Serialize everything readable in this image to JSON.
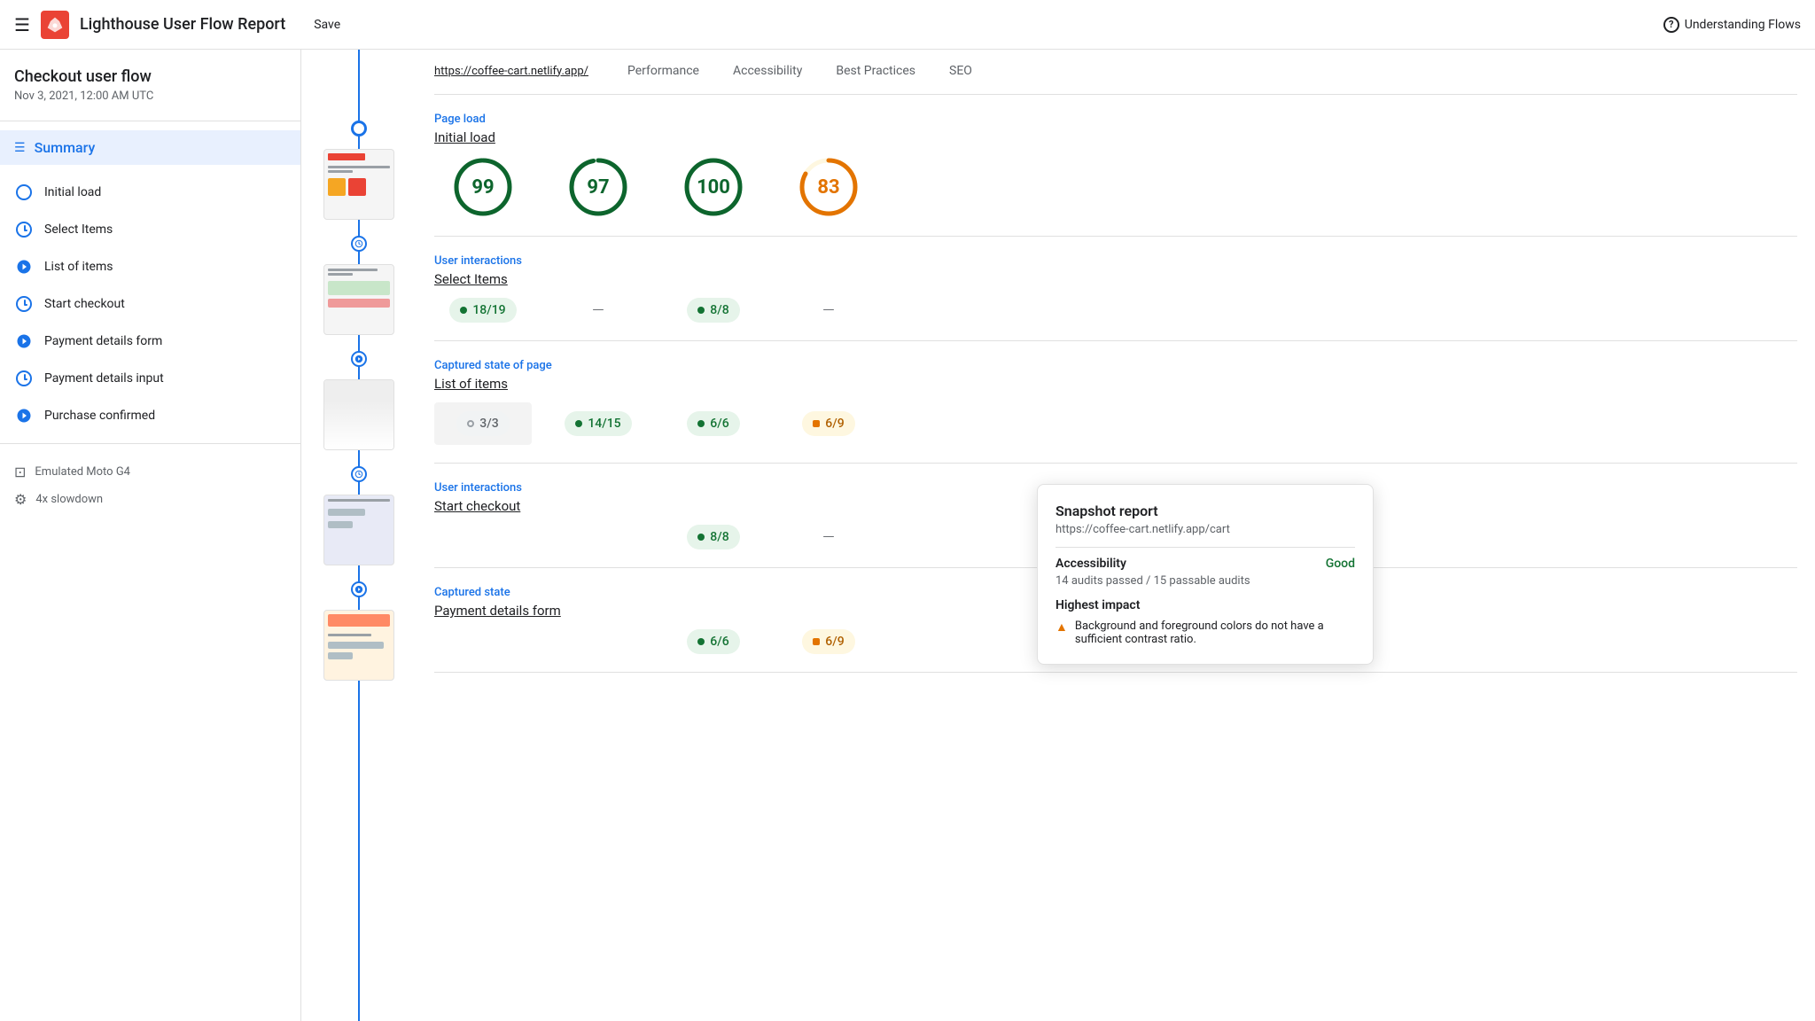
{
  "app": {
    "title": "Lighthouse User Flow Report",
    "save_label": "Save",
    "help_label": "Understanding Flows",
    "logo_icon": "lighthouse-icon"
  },
  "sidebar": {
    "flow_title": "Checkout user flow",
    "flow_date": "Nov 3, 2021, 12:00 AM UTC",
    "summary_label": "Summary",
    "nav_items": [
      {
        "id": "initial-load",
        "label": "Initial load",
        "type": "circle"
      },
      {
        "id": "select-items",
        "label": "Select Items",
        "type": "clock"
      },
      {
        "id": "list-of-items",
        "label": "List of items",
        "type": "snap"
      },
      {
        "id": "start-checkout",
        "label": "Start checkout",
        "type": "clock"
      },
      {
        "id": "payment-details-form",
        "label": "Payment details form",
        "type": "snap"
      },
      {
        "id": "payment-details-input",
        "label": "Payment details input",
        "type": "clock"
      },
      {
        "id": "purchase-confirmed",
        "label": "Purchase confirmed",
        "type": "snap"
      }
    ],
    "footer": [
      {
        "label": "Emulated Moto G4",
        "icon": "device-icon"
      },
      {
        "label": "4x slowdown",
        "icon": "slowdown-icon"
      }
    ]
  },
  "content": {
    "url": "https://coffee-cart.netlify.app/",
    "tabs": [
      {
        "id": "performance",
        "label": "Performance"
      },
      {
        "id": "accessibility",
        "label": "Accessibility"
      },
      {
        "id": "best-practices",
        "label": "Best Practices"
      },
      {
        "id": "seo",
        "label": "SEO"
      }
    ],
    "sections": [
      {
        "id": "page-load",
        "type_label": "Page load",
        "name_label": "Initial load",
        "scores": [
          {
            "type": "circle",
            "value": "99",
            "color": "green"
          },
          {
            "type": "circle",
            "value": "97",
            "color": "green"
          },
          {
            "type": "circle",
            "value": "100",
            "color": "green"
          },
          {
            "type": "circle",
            "value": "83",
            "color": "orange"
          }
        ]
      },
      {
        "id": "user-interactions-1",
        "type_label": "User interactions",
        "name_label": "Select Items",
        "scores": [
          {
            "type": "badge",
            "value": "18/19",
            "color": "green",
            "dot": "green"
          },
          {
            "type": "dash"
          },
          {
            "type": "badge",
            "value": "8/8",
            "color": "green",
            "dot": "green"
          },
          {
            "type": "dash"
          }
        ]
      },
      {
        "id": "captured-state-1",
        "type_label": "Captured state of page",
        "name_label": "List of items",
        "highlighted_col": 0,
        "scores": [
          {
            "type": "badge",
            "value": "3/3",
            "color": "gray",
            "dot": "empty"
          },
          {
            "type": "badge",
            "value": "14/15",
            "color": "green",
            "dot": "green"
          },
          {
            "type": "badge",
            "value": "6/6",
            "color": "green",
            "dot": "green"
          },
          {
            "type": "badge",
            "value": "6/9",
            "color": "orange",
            "dot": "orange"
          }
        ]
      },
      {
        "id": "user-interactions-2",
        "type_label": "User interactions",
        "name_label": "Start checkout",
        "scores": [
          {
            "type": "hidden"
          },
          {
            "type": "hidden"
          },
          {
            "type": "badge",
            "value": "8/8",
            "color": "green",
            "dot": "green"
          },
          {
            "type": "dash"
          }
        ]
      },
      {
        "id": "captured-state-2",
        "type_label": "Captured state",
        "name_label": "Payment details form",
        "scores": [
          {
            "type": "hidden"
          },
          {
            "type": "hidden"
          },
          {
            "type": "badge",
            "value": "6/6",
            "color": "green",
            "dot": "green"
          },
          {
            "type": "badge",
            "value": "6/9",
            "color": "orange",
            "dot": "orange"
          }
        ]
      }
    ]
  },
  "tooltip": {
    "title": "Snapshot report",
    "url": "https://coffee-cart.netlify.app/cart",
    "section1_title": "Accessibility",
    "section1_status": "Good",
    "section1_desc": "14 audits passed / 15 passable audits",
    "section2_title": "Highest impact",
    "impact_text": "Background and foreground colors do not have a sufficient contrast ratio."
  },
  "colors": {
    "green": "#0d652d",
    "orange": "#e37400",
    "blue": "#1a73e8",
    "green_bg": "#e6f4ea",
    "orange_bg": "#fef7e0"
  }
}
